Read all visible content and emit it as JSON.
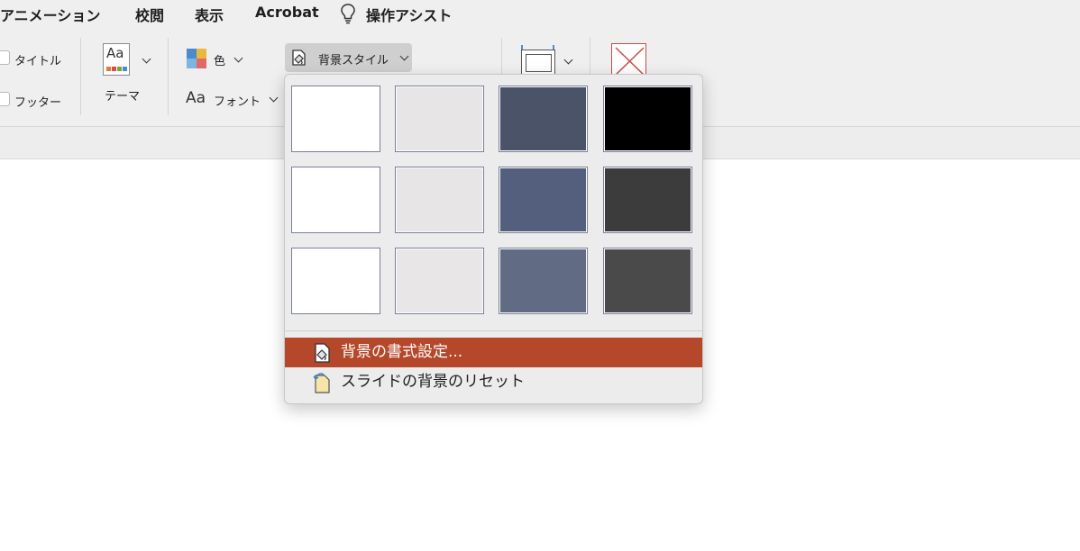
{
  "tabs": [
    "アニメーション",
    "校閲",
    "表示",
    "Acrobat",
    "操作アシスト"
  ],
  "ribbon": {
    "title_label": "タイトル",
    "footer_label": "フッター",
    "theme_label": "テーマ",
    "theme_icon_text": "Aa",
    "colors_label": "色",
    "fonts_icon_text": "Aa",
    "fonts_label": "フォント",
    "bgstyle_label": "背景スタイル"
  },
  "background_styles": {
    "swatches": [
      [
        "#ffffff",
        "#e7e5e6",
        "#4b5369",
        "#000000"
      ],
      [
        "#ffffff",
        "#e7e5e6",
        "#545f7d",
        "#3c3c3c"
      ],
      [
        "#ffffff",
        "#e8e6e7",
        "#616b83",
        "#4a4a4a"
      ]
    ]
  },
  "menu": {
    "format_background": "背景の書式設定...",
    "reset_background": "スライドの背景のリセット"
  },
  "colors": {
    "highlight": "#b5472a",
    "ribbon_bg": "#f0efef",
    "swatch_border": "#7a8194"
  },
  "icons": {
    "assist": "lightbulb-icon",
    "theme": "theme-aa-icon",
    "colors": "color-squares-icon",
    "bgstyle": "background-style-icon",
    "slide_size": "slide-size-icon",
    "format": "format-background-icon",
    "reset": "reset-background-icon"
  }
}
